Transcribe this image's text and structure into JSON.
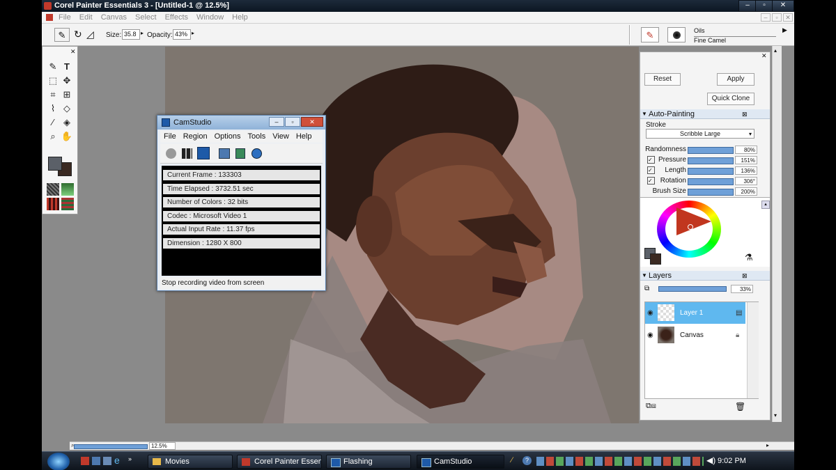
{
  "window": {
    "title": "Corel Painter Essentials 3 - [Untitled-1 @ 12.5%]"
  },
  "menu": [
    "File",
    "Edit",
    "Canvas",
    "Select",
    "Effects",
    "Window",
    "Help"
  ],
  "propbar": {
    "size_label": "Size:",
    "size_value": "35.8",
    "opacity_label": "Opacity:",
    "opacity_value": "43%",
    "brush_category": "Oils",
    "brush_variant": "Fine Camel"
  },
  "camstudio": {
    "title": "CamStudio",
    "menu": [
      "File",
      "Region",
      "Options",
      "Tools",
      "View",
      "Help"
    ],
    "info": [
      "Current Frame : 133303",
      "Time Elapsed : 3732.51 sec",
      "Number of Colors : 32 bits",
      "Codec : Microsoft Video 1",
      "Actual Input Rate : 11.37 fps",
      "Dimension : 1280 X 800"
    ],
    "status": "Stop recording video from screen"
  },
  "panel": {
    "reset": "Reset",
    "apply": "Apply",
    "quick_clone": "Quick Clone",
    "auto_painting": "Auto-Painting",
    "stroke_label": "Stroke",
    "stroke_value": "Scribble Large",
    "sliders": [
      {
        "label": "Randomness",
        "value": "80%",
        "checked": false
      },
      {
        "label": "Pressure",
        "value": "151%",
        "checked": true
      },
      {
        "label": "Length",
        "value": "136%",
        "checked": true
      },
      {
        "label": "Rotation",
        "value": "306°",
        "checked": true
      },
      {
        "label": "Brush Size",
        "value": "200%",
        "checked": false
      }
    ],
    "layers_title": "Layers",
    "layer_opacity": "33%",
    "layers": [
      {
        "name": "Layer 1",
        "selected": true
      },
      {
        "name": "Canvas",
        "selected": false
      }
    ]
  },
  "zoom": "12.5%",
  "taskbar": {
    "tasks": [
      {
        "label": "Movies",
        "active": false
      },
      {
        "label": "Corel Painter Essen...",
        "active": false
      },
      {
        "label": "Flashing",
        "active": false
      },
      {
        "label": "CamStudio",
        "active": true
      }
    ],
    "clock": "9:02 PM"
  },
  "colors": {
    "main": "#3b2a22",
    "layer_highlight": "#5fb8ef"
  }
}
